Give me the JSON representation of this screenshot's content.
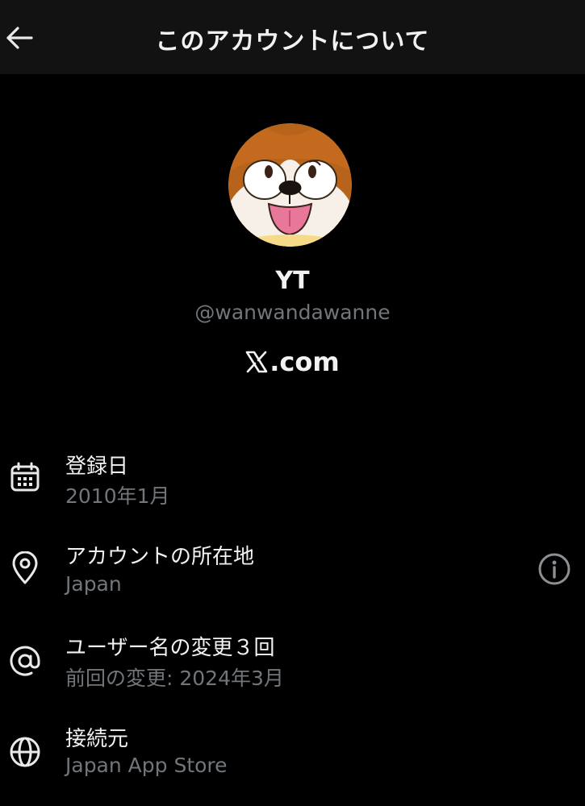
{
  "header": {
    "title": "このアカウントについて",
    "back_icon": "arrow-left-icon"
  },
  "profile": {
    "display_name": "YT",
    "handle": "@wanwandawanne",
    "platform": ".com",
    "avatar": "dog-face-avatar"
  },
  "details": [
    {
      "icon": "calendar-icon",
      "label": "登録日",
      "value": "2010年1月"
    },
    {
      "icon": "location-pin-icon",
      "label": "アカウントの所在地",
      "value": "Japan",
      "info_icon": "info-circle-icon"
    },
    {
      "icon": "at-sign-icon",
      "label": "ユーザー名の変更３回",
      "value": "前回の変更: 2024年3月"
    },
    {
      "icon": "globe-icon",
      "label": "接続元",
      "value": "Japan App Store"
    }
  ],
  "colors": {
    "background": "#000000",
    "header_background": "#121212",
    "primary_text": "#e7e9ea",
    "secondary_text": "#71767b",
    "avatar_fur": "#b8631c"
  }
}
